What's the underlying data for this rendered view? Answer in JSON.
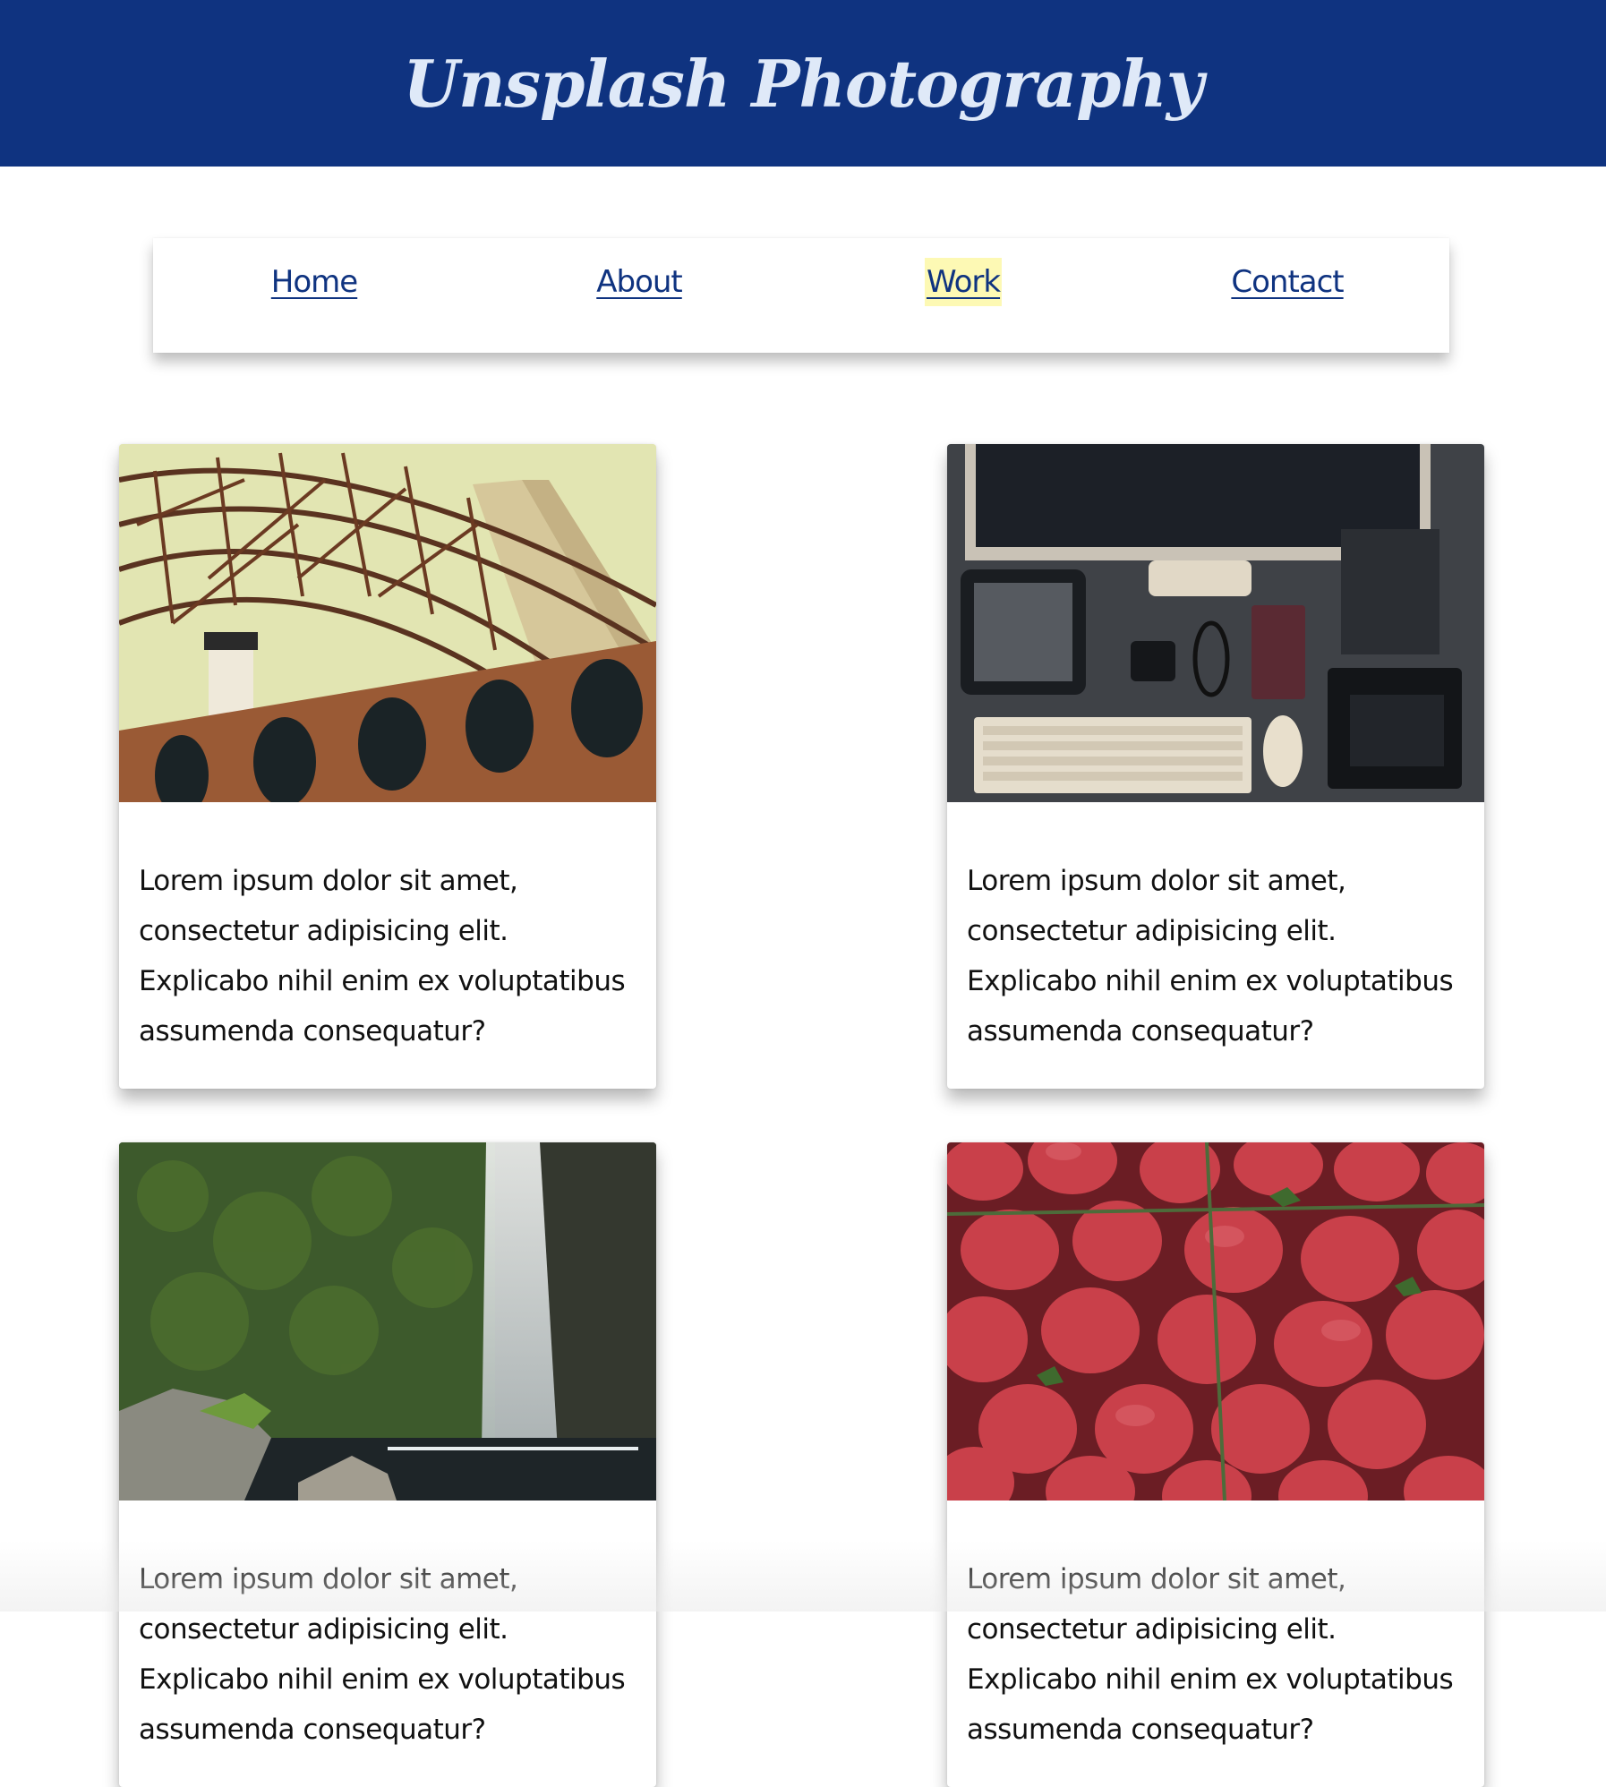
{
  "header": {
    "title": "Unsplash Photography"
  },
  "nav": {
    "items": [
      {
        "label": "Home"
      },
      {
        "label": "About"
      },
      {
        "label": "Work"
      },
      {
        "label": "Contact"
      }
    ],
    "active": "Work"
  },
  "cards": [
    {
      "image": "golden-gate-bridge-photo",
      "text": "Lorem ipsum dolor sit amet, consectetur adipisicing elit. Explicabo nihil enim ex voluptatibus assumenda consequatur?"
    },
    {
      "image": "desk-workspace-photo",
      "text": "Lorem ipsum dolor sit amet, consectetur adipisicing elit. Explicabo nihil enim ex voluptatibus assumenda consequatur?"
    },
    {
      "image": "waterfall-photo",
      "text": "Lorem ipsum dolor sit amet, consectetur adipisicing elit. Explicabo nihil enim ex voluptatibus assumenda consequatur?"
    },
    {
      "image": "strawberries-photo",
      "text": "Lorem ipsum dolor sit amet, consectetur adipisicing elit. Explicabo nihil enim ex voluptatibus assumenda consequatur?"
    }
  ],
  "colors": {
    "header_bg": "#0f3380",
    "title_text": "#dfe9f8",
    "nav_link": "#0f3380",
    "active_highlight": "#fdf9b4"
  }
}
